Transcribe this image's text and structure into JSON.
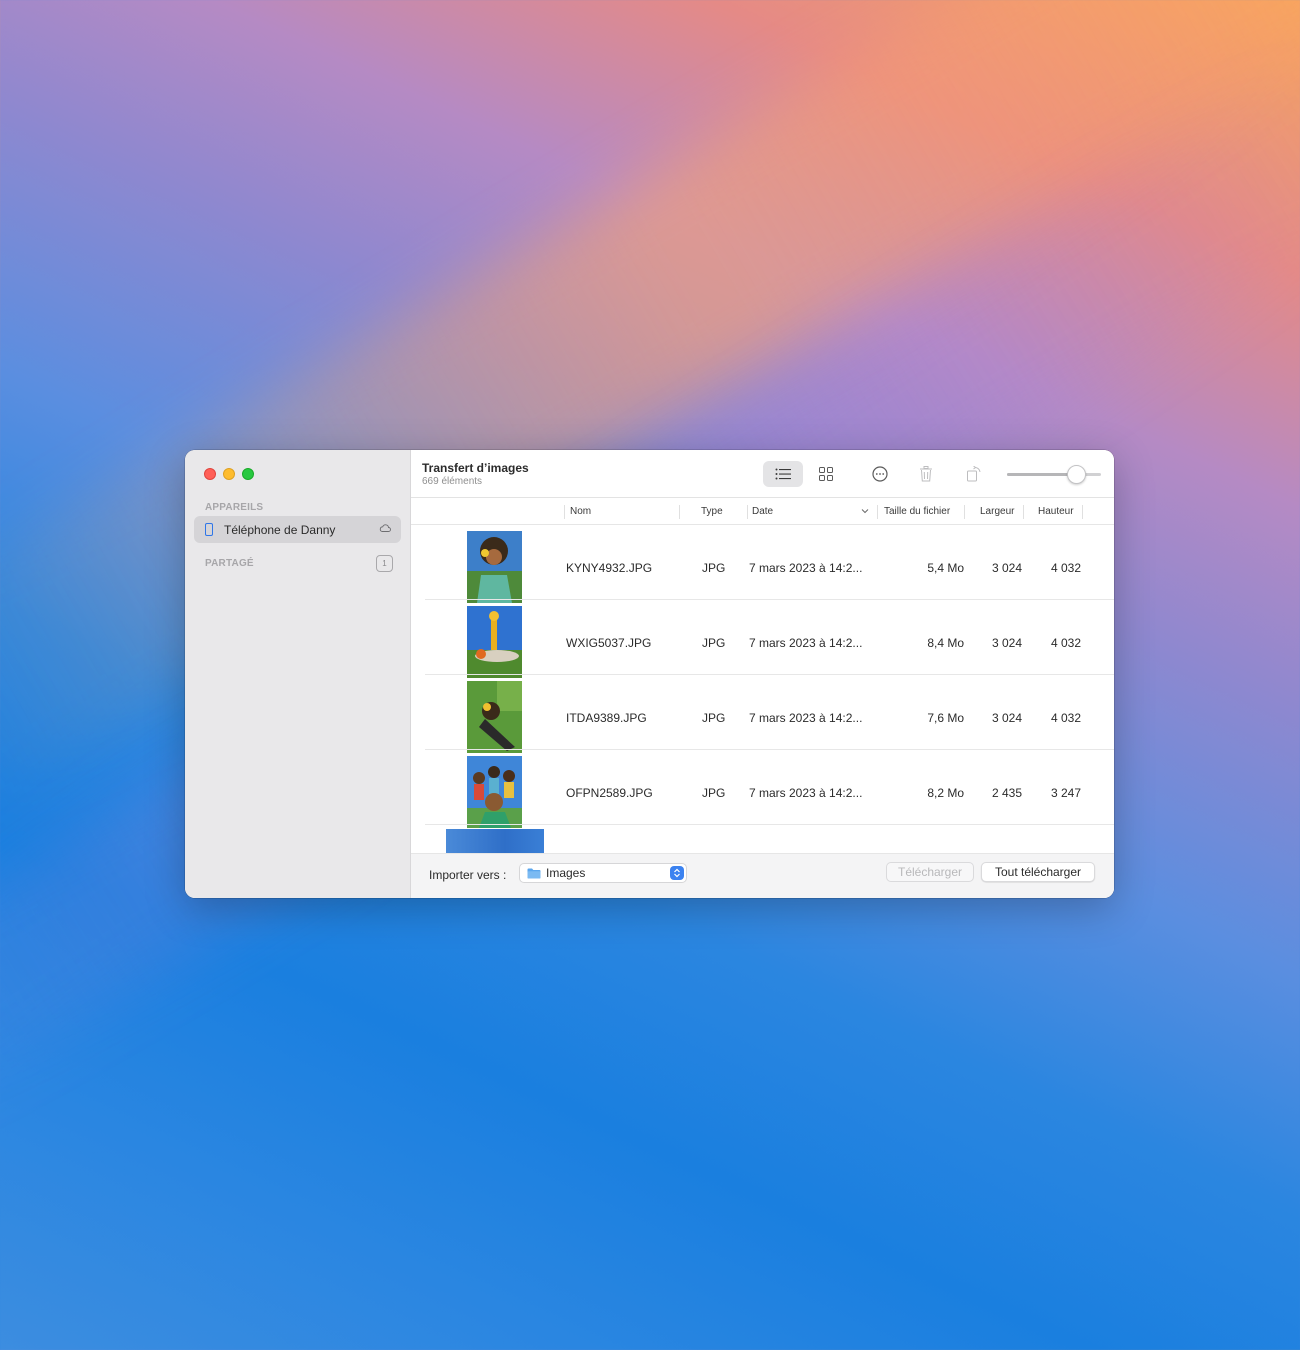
{
  "window": {
    "title": "Transfert d’images",
    "subtitle": "669 éléments"
  },
  "sidebar": {
    "devices_header": "APPAREILS",
    "device_name": "Téléphone de Danny",
    "shared_header": "PARTAGÉ",
    "shared_count": "1"
  },
  "toolbar": {
    "list_view_icon": "list-icon",
    "grid_view_icon": "grid-icon",
    "more_icon": "ellipsis-circle-icon",
    "trash_icon": "trash-icon",
    "rotate_icon": "rotate-icon",
    "thumbnail_size_level": 0.74
  },
  "table": {
    "columns": {
      "name": "Nom",
      "type": "Type",
      "date": "Date",
      "size": "Taille du fichier",
      "width": "Largeur",
      "height": "Hauteur"
    },
    "rows": [
      {
        "name": "KYNY4932.JPG",
        "type": "JPG",
        "date": "7 mars 2023 à 14:2...",
        "size": "5,4 Mo",
        "width": "3 024",
        "height": "4 032"
      },
      {
        "name": "WXIG5037.JPG",
        "type": "JPG",
        "date": "7 mars 2023 à 14:2...",
        "size": "8,4 Mo",
        "width": "3 024",
        "height": "4 032"
      },
      {
        "name": "ITDA9389.JPG",
        "type": "JPG",
        "date": "7 mars 2023 à 14:2...",
        "size": "7,6 Mo",
        "width": "3 024",
        "height": "4 032"
      },
      {
        "name": "OFPN2589.JPG",
        "type": "JPG",
        "date": "7 mars 2023 à 14:2...",
        "size": "8,2 Mo",
        "width": "2 435",
        "height": "3 247"
      }
    ]
  },
  "footer": {
    "import_label": "Importer vers :",
    "destination": "Images",
    "download_label": "Télécharger",
    "download_all_label": "Tout télécharger"
  },
  "colors": {
    "accent": "#3b82f0",
    "close": "#ff5f57",
    "minimize": "#febc2e",
    "maximize": "#28c840"
  }
}
